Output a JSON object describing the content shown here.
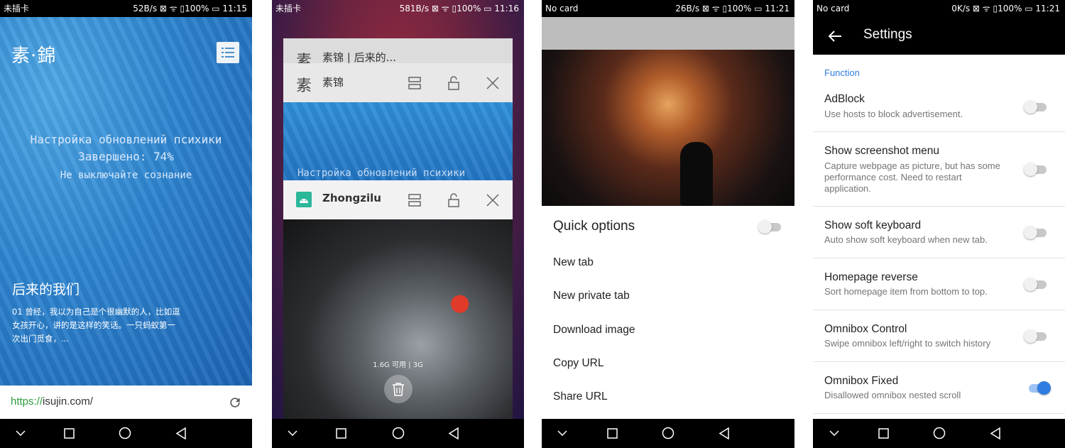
{
  "phone1": {
    "status_left": "未插卡",
    "status_right": "52B/s ⊠ ᯤ ▯100% ▭ 11:15",
    "logo": "素·錦",
    "handwriting": [
      "Настройка обновлений психики",
      "Завершено: 74%",
      "Не выключайте сознание"
    ],
    "post_title": "后来的我们",
    "post_excerpt": "01 曾经，我以为自己是个很幽默的人，比如逗女孩开心，讲的是这样的笑话。一只蚂蚁第一次出门觅食，...",
    "url_proto": "https://",
    "url_host": "isujin.com/"
  },
  "phone2": {
    "status_left": "未插卡",
    "status_right": "581B/s ⊠ ᯤ ▯100% ▭ 11:16",
    "tabs": [
      {
        "title": "素锦 | 后来的...",
        "icon": "素"
      },
      {
        "title": "素锦",
        "icon": "素"
      },
      {
        "title": "Zhongzilu",
        "icon": "android-icon"
      }
    ],
    "preview_text": "Настройка обновлений психики",
    "memory": "1.6G 可用 | 3G"
  },
  "phone3": {
    "status_left": "No card",
    "status_right": "26B/s ⊠ ᯤ ▯100% ▭ 11:21",
    "sheet_title": "Quick options",
    "quick_toggle": false,
    "items": [
      "New tab",
      "New private tab",
      "Download image",
      "Copy URL",
      "Share URL"
    ]
  },
  "phone4": {
    "status_left": "No card",
    "status_right": "0K/s ⊠ ᯤ ▯100% ▭ 11:21",
    "title": "Settings",
    "section": "Function",
    "rows": [
      {
        "title": "AdBlock",
        "summary": "Use hosts to block advertisement.",
        "on": false
      },
      {
        "title": "Show screenshot menu",
        "summary": "Capture webpage as picture, but has some performance cost. Need to restart application.",
        "on": false
      },
      {
        "title": "Show soft keyboard",
        "summary": "Auto show soft keyboard when new tab.",
        "on": false
      },
      {
        "title": "Homepage reverse",
        "summary": "Sort homepage item from bottom to top.",
        "on": false
      },
      {
        "title": "Omnibox Control",
        "summary": "Swipe omnibox left/right to switch history",
        "on": false
      },
      {
        "title": "Omnibox Fixed",
        "summary": "Disallowed omnibox nested scroll",
        "on": true
      }
    ]
  },
  "colors": {
    "accent": "#2f7de1",
    "url_green": "#2e9b3e",
    "toggle_off": "#c8c8c8"
  }
}
